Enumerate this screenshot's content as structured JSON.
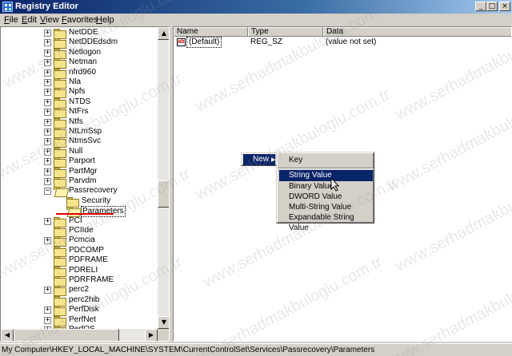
{
  "window": {
    "title": "Registry Editor"
  },
  "title_buttons": {
    "minimize": "_",
    "maximize": "□",
    "close": "×"
  },
  "menu": {
    "items": [
      "File",
      "Edit",
      "View",
      "Favorites",
      "Help"
    ]
  },
  "tree": {
    "nodes": [
      {
        "label": "NetDDE",
        "expander": "+"
      },
      {
        "label": "NetDDEdsdm",
        "expander": "+"
      },
      {
        "label": "Netlogon",
        "expander": "+"
      },
      {
        "label": "Netman",
        "expander": "+"
      },
      {
        "label": "nfrd960",
        "expander": "+"
      },
      {
        "label": "Nla",
        "expander": "+"
      },
      {
        "label": "Npfs",
        "expander": "+"
      },
      {
        "label": "NTDS",
        "expander": "+"
      },
      {
        "label": "NtFrs",
        "expander": "+"
      },
      {
        "label": "Ntfs",
        "expander": "+"
      },
      {
        "label": "NtLmSsp",
        "expander": "+"
      },
      {
        "label": "NtmsSvc",
        "expander": "+"
      },
      {
        "label": "Null",
        "expander": "+"
      },
      {
        "label": "Parport",
        "expander": "+"
      },
      {
        "label": "PartMgr",
        "expander": "+"
      },
      {
        "label": "Parvdm",
        "expander": "+"
      },
      {
        "label": "Passrecovery",
        "expander": "−"
      },
      {
        "label": "Security",
        "expander": "",
        "child": true
      },
      {
        "label": "Parameters",
        "expander": "",
        "child": true,
        "selected": true
      },
      {
        "label": "PCI",
        "expander": "+"
      },
      {
        "label": "PCIIde",
        "expander": ""
      },
      {
        "label": "Pcmcia",
        "expander": "+"
      },
      {
        "label": "PDCOMP",
        "expander": ""
      },
      {
        "label": "PDFRAME",
        "expander": ""
      },
      {
        "label": "PDRELI",
        "expander": ""
      },
      {
        "label": "PDRFRAME",
        "expander": ""
      },
      {
        "label": "perc2",
        "expander": "+"
      },
      {
        "label": "perc2hib",
        "expander": ""
      },
      {
        "label": "PerfDisk",
        "expander": "+"
      },
      {
        "label": "PerfNet",
        "expander": "+"
      },
      {
        "label": "PerfOS",
        "expander": "+"
      }
    ]
  },
  "list": {
    "columns": [
      "Name",
      "Type",
      "Data"
    ],
    "rows": [
      {
        "name": "(Default)",
        "type": "REG_SZ",
        "data": "(value not set)"
      }
    ],
    "value_icon": "ab"
  },
  "context_menu": {
    "new_label": "New",
    "submenu": {
      "items": [
        "Key",
        "String Value",
        "Binary Value",
        "DWORD Value",
        "Multi-String Value",
        "Expandable String Value"
      ],
      "highlighted": "String Value"
    }
  },
  "status": {
    "path": "My Computer\\HKEY_LOCAL_MACHINE\\SYSTEM\\CurrentControlSet\\Services\\Passrecovery\\Parameters"
  },
  "watermark": "www.serhadmakbuloglu.com.tr",
  "colors": {
    "highlight": "#0a246a",
    "annotation": "#e00000"
  }
}
